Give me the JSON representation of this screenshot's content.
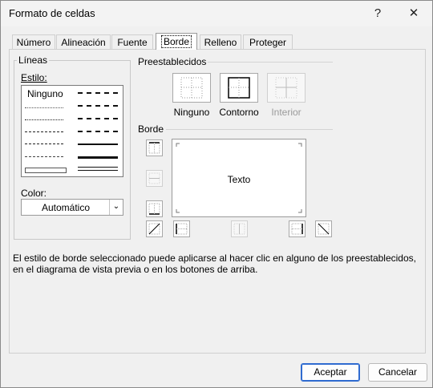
{
  "window": {
    "title": "Formato de celdas",
    "help_glyph": "?",
    "close_glyph": "✕"
  },
  "tabs": [
    {
      "label": "Número"
    },
    {
      "label": "Alineación"
    },
    {
      "label": "Fuente"
    },
    {
      "label": "Borde",
      "active": true
    },
    {
      "label": "Relleno"
    },
    {
      "label": "Proteger"
    }
  ],
  "lines": {
    "group_label": "Líneas",
    "style_label": "Estilo:",
    "style_none": "Ninguno",
    "color_label": "Color:",
    "color_value": "Automático"
  },
  "presets": {
    "group_label": "Preestablecidos",
    "items": [
      {
        "label": "Ninguno",
        "enabled": true
      },
      {
        "label": "Contorno",
        "enabled": true
      },
      {
        "label": "Interior",
        "enabled": false
      }
    ]
  },
  "border": {
    "group_label": "Borde",
    "preview_text": "Texto"
  },
  "description": "El estilo de borde seleccionado puede aplicarse al hacer clic en alguno de los preestablecidos, en el diagrama de vista previa o en los botones de arriba.",
  "buttons": {
    "ok": "Aceptar",
    "cancel": "Cancelar"
  },
  "colors": {
    "default_button_border": "#2f6bd0",
    "background": "#f0f0f0"
  }
}
